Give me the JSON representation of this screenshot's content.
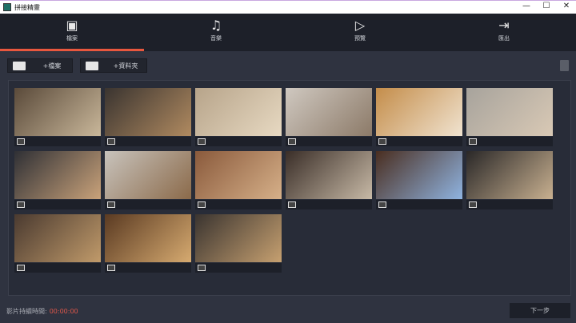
{
  "window": {
    "title": "拼接精靈",
    "minimize": "—",
    "maximize": "☐",
    "close": "✕"
  },
  "tabs": [
    {
      "label": "檔案",
      "icon": "files-icon",
      "glyph": "▣"
    },
    {
      "label": "音樂",
      "icon": "music-icon",
      "glyph": "♫"
    },
    {
      "label": "預覽",
      "icon": "preview-icon",
      "glyph": "▷"
    },
    {
      "label": "匯出",
      "icon": "export-icon",
      "glyph": "⇥"
    }
  ],
  "toolbar": {
    "add_file": "+檔案",
    "add_folder": "+資料夾"
  },
  "photos": [
    {
      "type": "image",
      "colors": [
        "#5a4a3a",
        "#c9b79a"
      ]
    },
    {
      "type": "image",
      "colors": [
        "#3a3430",
        "#b08a60"
      ]
    },
    {
      "type": "image",
      "colors": [
        "#b7a48a",
        "#e7d9c2"
      ]
    },
    {
      "type": "image",
      "colors": [
        "#cfc8c0",
        "#8c7a68"
      ]
    },
    {
      "type": "image",
      "colors": [
        "#c48d4a",
        "#f0e3d0"
      ]
    },
    {
      "type": "image",
      "colors": [
        "#a7a39c",
        "#d9c9b5"
      ]
    },
    {
      "type": "image",
      "colors": [
        "#2f3035",
        "#c9a27a"
      ]
    },
    {
      "type": "image",
      "colors": [
        "#c8c3bc",
        "#8b6a4a"
      ]
    },
    {
      "type": "image",
      "colors": [
        "#8a5a3c",
        "#d6b089"
      ]
    },
    {
      "type": "image",
      "colors": [
        "#3a2e28",
        "#c7b9a6"
      ]
    },
    {
      "type": "image",
      "colors": [
        "#4a2e20",
        "#8fb3e0"
      ]
    },
    {
      "type": "image",
      "colors": [
        "#2a2828",
        "#c8b090"
      ]
    },
    {
      "type": "image",
      "colors": [
        "#4a3a30",
        "#c09a6a"
      ]
    },
    {
      "type": "image",
      "colors": [
        "#5a3a22",
        "#d6aa70"
      ]
    },
    {
      "type": "image",
      "colors": [
        "#3a3430",
        "#c6a070"
      ]
    }
  ],
  "footer": {
    "duration_label": "影片持續時間:",
    "duration_value": "00:00:00",
    "next": "下一步"
  }
}
